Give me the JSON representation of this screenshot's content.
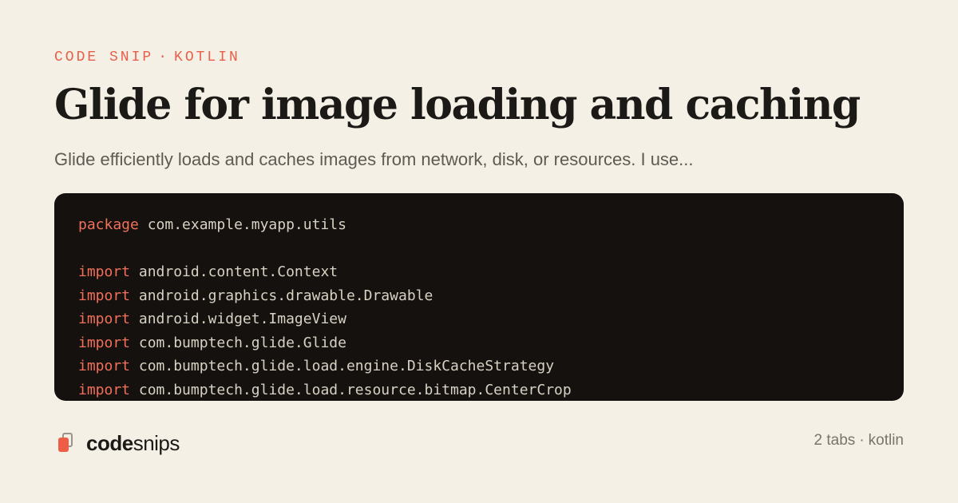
{
  "header": {
    "eyebrow_label": "CODE SNIP",
    "eyebrow_separator": "·",
    "eyebrow_language": "KOTLIN",
    "title": "Glide for image loading and caching",
    "description": "Glide efficiently loads and caches images from network, disk, or resources. I use..."
  },
  "code": {
    "lines": [
      {
        "keyword": "package",
        "rest": " com.example.myapp.utils"
      },
      {
        "keyword": "",
        "rest": ""
      },
      {
        "keyword": "import",
        "rest": " android.content.Context"
      },
      {
        "keyword": "import",
        "rest": " android.graphics.drawable.Drawable"
      },
      {
        "keyword": "import",
        "rest": " android.widget.ImageView"
      },
      {
        "keyword": "import",
        "rest": " com.bumptech.glide.Glide"
      },
      {
        "keyword": "import",
        "rest": " com.bumptech.glide.load.engine.DiskCacheStrategy"
      },
      {
        "keyword": "import",
        "rest": " com.bumptech.glide.load.resource.bitmap.CenterCrop"
      }
    ]
  },
  "footer": {
    "brand_bold": "code",
    "brand_regular": "snips",
    "logo_icon": "stacked-cards-icon",
    "meta_tabs": "2 tabs",
    "meta_separator": "·",
    "meta_language": "kotlin"
  },
  "colors": {
    "background": "#f5f0e6",
    "accent": "#e8604a",
    "code_background": "#15110e",
    "code_keyword": "#f0705a",
    "code_text": "#d8d2c4",
    "title_text": "#1c1a17",
    "muted_text": "#7a746a"
  }
}
